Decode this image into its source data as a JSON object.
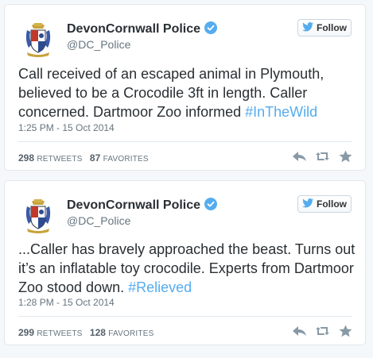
{
  "tweets": [
    {
      "name": "DevonCornwall Police",
      "handle": "@DC_Police",
      "follow_label": "Follow",
      "text": "Call received of an escaped animal in Plymouth, believed to be a Crocodile 3ft in length. Caller concerned. Dartmoor Zoo informed ",
      "hashtag": "#InTheWild",
      "timestamp": "1:25 PM - 15 Oct 2014",
      "retweets_count": "298",
      "retweets_label": "RETWEETS",
      "favorites_count": "87",
      "favorites_label": "FAVORITES"
    },
    {
      "name": "DevonCornwall Police",
      "handle": "@DC_Police",
      "follow_label": "Follow",
      "text": "...Caller has bravely approached the beast. Turns out it’s an inflatable toy crocodile. Experts from Dartmoor Zoo stood down. ",
      "hashtag": "#Relieved",
      "timestamp": "1:28 PM - 15 Oct 2014",
      "retweets_count": "299",
      "retweets_label": "RETWEETS",
      "favorites_count": "128",
      "favorites_label": "FAVORITES"
    }
  ],
  "colors": {
    "link": "#55acee",
    "verified": "#55acee",
    "text": "#292f33",
    "muted": "#66757f",
    "icon": "#8899a6"
  },
  "icons": [
    "police-crest-icon",
    "verified-badge-icon",
    "twitter-bird-icon",
    "reply-icon",
    "retweet-icon",
    "favorite-star-icon"
  ]
}
